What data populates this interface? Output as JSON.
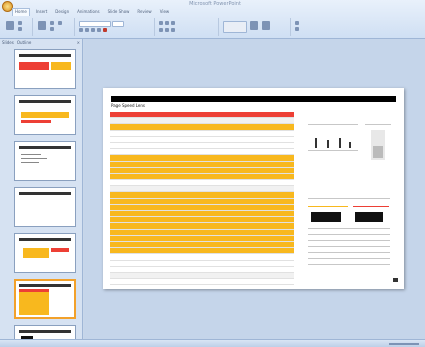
{
  "window": {
    "title": "Microsoft PowerPoint"
  },
  "ribbon": {
    "tabs": [
      "Home",
      "Insert",
      "Design",
      "Animations",
      "Slide Show",
      "Review",
      "View"
    ]
  },
  "thumb_pane": {
    "tabs": [
      "Slides",
      "Outline"
    ],
    "close": "×"
  },
  "slide": {
    "title": "Page Speed Lens",
    "table": {
      "rows": [
        {
          "c1": "",
          "c2": "",
          "c3": "",
          "style": "header"
        },
        {
          "c1": "",
          "c2": "",
          "c3": "",
          "style": "gray"
        },
        {
          "c1": "",
          "c2": "",
          "c3": "",
          "style": "orange"
        },
        {
          "c1": "",
          "c2": "",
          "c3": "",
          "style": "plain"
        },
        {
          "c1": "",
          "c2": "",
          "c3": "",
          "style": "plain"
        },
        {
          "c1": "",
          "c2": "",
          "c3": "",
          "style": "plain"
        },
        {
          "c1": "",
          "c2": "",
          "c3": "",
          "style": "plain"
        },
        {
          "c1": "",
          "c2": "",
          "c3": "",
          "style": "orange"
        },
        {
          "c1": "",
          "c2": "",
          "c3": "",
          "style": "orange"
        },
        {
          "c1": "",
          "c2": "",
          "c3": "",
          "style": "orange"
        },
        {
          "c1": "",
          "c2": "",
          "c3": "",
          "style": "orange"
        },
        {
          "c1": "",
          "c2": "",
          "c3": "",
          "style": "plain"
        },
        {
          "c1": "",
          "c2": "",
          "c3": "",
          "style": "gray"
        },
        {
          "c1": "",
          "c2": "",
          "c3": "",
          "style": "orange"
        },
        {
          "c1": "",
          "c2": "",
          "c3": "",
          "style": "orange"
        },
        {
          "c1": "",
          "c2": "",
          "c3": "",
          "style": "orange"
        },
        {
          "c1": "",
          "c2": "",
          "c3": "",
          "style": "orange"
        },
        {
          "c1": "",
          "c2": "",
          "c3": "",
          "style": "orange"
        },
        {
          "c1": "",
          "c2": "",
          "c3": "",
          "style": "orange"
        },
        {
          "c1": "",
          "c2": "",
          "c3": "",
          "style": "orange"
        },
        {
          "c1": "",
          "c2": "",
          "c3": "",
          "style": "orange"
        },
        {
          "c1": "",
          "c2": "",
          "c3": "",
          "style": "orange"
        },
        {
          "c1": "",
          "c2": "",
          "c3": "",
          "style": "orange"
        },
        {
          "c1": "",
          "c2": "",
          "c3": "",
          "style": "plain"
        },
        {
          "c1": "",
          "c2": "",
          "c3": "",
          "style": "plain"
        },
        {
          "c1": "",
          "c2": "",
          "c3": "",
          "style": "plain"
        },
        {
          "c1": "",
          "c2": "",
          "c3": "",
          "style": "gray"
        },
        {
          "c1": "",
          "c2": "",
          "c3": "",
          "style": "plain"
        },
        {
          "c1": "",
          "c2": "",
          "c3": "",
          "style": "plain"
        }
      ]
    }
  },
  "colors": {
    "table_header": "#ed3f35",
    "table_highlight": "#f8b81e",
    "selected_thumb_border": "#f2a12b",
    "app_background": "#c8d7ea"
  }
}
